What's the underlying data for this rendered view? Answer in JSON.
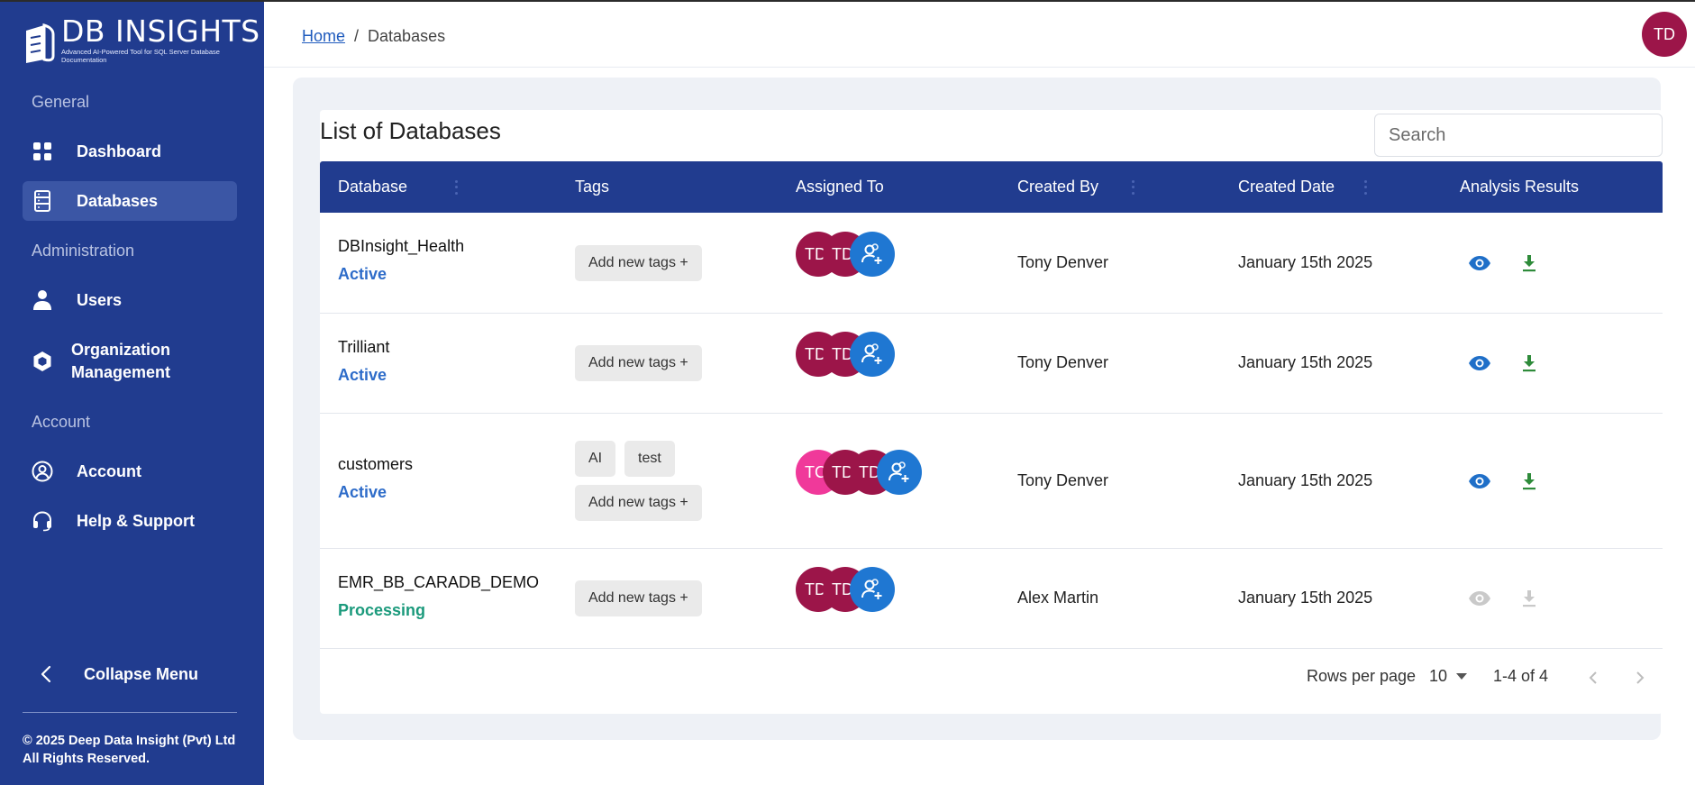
{
  "app": {
    "logo_title": "DB INSIGHTS",
    "logo_subtitle": "Advanced AI-Powered Tool for SQL Server Database Documentation",
    "brand_color": "#213c8f"
  },
  "sidebar": {
    "sections": {
      "general": "General",
      "administration": "Administration",
      "account": "Account"
    },
    "items": [
      {
        "label": "Dashboard",
        "icon": "grid-icon"
      },
      {
        "label": "Databases",
        "icon": "database-icon",
        "active": true
      },
      {
        "label": "Users",
        "icon": "user-icon"
      },
      {
        "label": "Organization Management",
        "line1": "Organization",
        "line2": "Management",
        "icon": "hexagon-icon"
      },
      {
        "label": "Account",
        "icon": "account-circle-icon"
      },
      {
        "label": "Help & Support",
        "icon": "headset-icon"
      }
    ],
    "collapse_label": "Collapse Menu",
    "copyright_line1": "© 2025 Deep Data Insight (Pvt) Ltd",
    "copyright_line2": "All Rights Reserved."
  },
  "header": {
    "breadcrumb_home": "Home",
    "breadcrumb_sep": "/",
    "breadcrumb_current": "Databases",
    "user_initials": "TD"
  },
  "main": {
    "title": "List of Databases",
    "search_placeholder": "Search",
    "columns": [
      "Database",
      "Tags",
      "Assigned To",
      "Created By",
      "Created Date",
      "Analysis Results"
    ],
    "rows": [
      {
        "name": "DBInsight_Health",
        "status": "Active",
        "tags": [],
        "add_tag_label": "Add new tags +",
        "assignees": [
          "TD",
          "TD"
        ],
        "created_by": "Tony Denver",
        "created_date": "January 15th 2025",
        "results_enabled": true
      },
      {
        "name": "Trilliant",
        "status": "Active",
        "tags": [],
        "add_tag_label": "Add new tags +",
        "assignees": [
          "TD",
          "TD"
        ],
        "created_by": "Tony Denver",
        "created_date": "January 15th 2025",
        "results_enabled": true
      },
      {
        "name": "customers",
        "status": "Active",
        "tags": [
          "AI",
          "test"
        ],
        "add_tag_label": "Add new tags +",
        "assignees": [
          "TC",
          "TD",
          "TD"
        ],
        "created_by": "Tony Denver",
        "created_date": "January 15th 2025",
        "results_enabled": true
      },
      {
        "name": "EMR_BB_CARADB_DEMO",
        "status": "Processing",
        "tags": [],
        "add_tag_label": "Add new tags +",
        "assignees": [
          "TD",
          "TD"
        ],
        "created_by": "Alex Martin",
        "created_date": "January 15th 2025",
        "results_enabled": false
      }
    ],
    "pagination": {
      "rows_per_page_label": "Rows per page",
      "rows_per_page_value": "10",
      "range": "1-4 of 4"
    }
  },
  "colors": {
    "avatar_maroon": "#9c1549",
    "avatar_pink": "#f0399a",
    "add_assignee_blue": "#1f77d2",
    "status_active": "#2e6cc9",
    "status_processing": "#1b9a7c",
    "view_icon": "#1f6fc8",
    "download_icon": "#2e8b3a",
    "disabled_icon": "#c9c9c9"
  }
}
